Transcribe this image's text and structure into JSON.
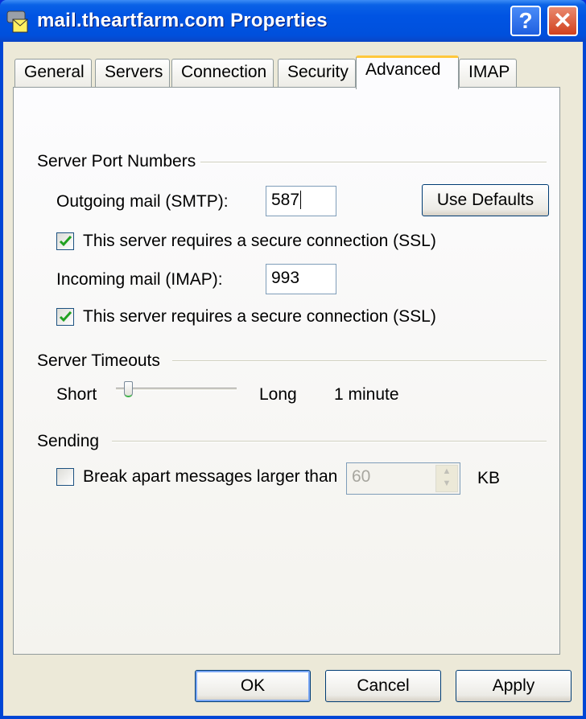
{
  "window": {
    "title": "mail.theartfarm.com Properties",
    "help_label": "?",
    "close_label": "✕"
  },
  "tabs": [
    {
      "label": "General"
    },
    {
      "label": "Servers"
    },
    {
      "label": "Connection"
    },
    {
      "label": "Security"
    },
    {
      "label": "Advanced",
      "active": true
    },
    {
      "label": "IMAP"
    }
  ],
  "ports": {
    "group_label": "Server Port Numbers",
    "smtp_label": "Outgoing mail (SMTP):",
    "smtp_value": "587",
    "use_defaults_label": "Use Defaults",
    "smtp_ssl_label": "This server requires a secure connection (SSL)",
    "smtp_ssl_checked": true,
    "imap_label": "Incoming mail (IMAP):",
    "imap_value": "993",
    "imap_ssl_label": "This server requires a secure connection (SSL)",
    "imap_ssl_checked": true
  },
  "timeouts": {
    "group_label": "Server Timeouts",
    "short_label": "Short",
    "long_label": "Long",
    "value_label": "1 minute",
    "slider_fraction": 0.1
  },
  "sending": {
    "group_label": "Sending",
    "break_label": "Break apart messages larger than",
    "break_checked": false,
    "size_value": "60",
    "unit_label": "KB"
  },
  "footer": {
    "ok_label": "OK",
    "cancel_label": "Cancel",
    "apply_label": "Apply"
  },
  "colors": {
    "titlebar": "#0054e3",
    "face": "#ece9d8",
    "tab_highlight": "#ffc83c",
    "check": "#21a121"
  }
}
